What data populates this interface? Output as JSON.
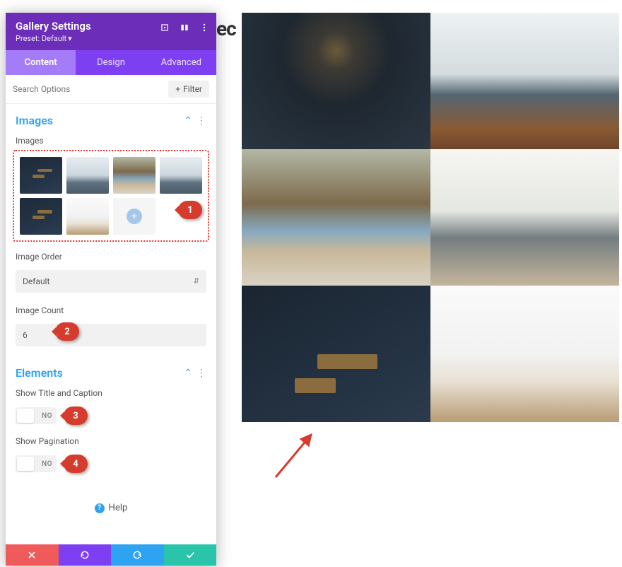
{
  "bg_text": "ec",
  "header": {
    "title": "Gallery Settings",
    "preset_label": "Preset: Default"
  },
  "tabs": {
    "content": "Content",
    "design": "Design",
    "advanced": "Advanced"
  },
  "search": {
    "placeholder": "Search Options",
    "filter_label": "Filter"
  },
  "sections": {
    "images": {
      "title": "Images",
      "images_label": "Images",
      "order_label": "Image Order",
      "order_value": "Default",
      "count_label": "Image Count",
      "count_value": "6"
    },
    "elements": {
      "title": "Elements",
      "title_caption_label": "Show Title and Caption",
      "title_caption_value": "NO",
      "pagination_label": "Show Pagination",
      "pagination_value": "NO"
    }
  },
  "help_label": "Help",
  "annotations": {
    "b1": "1",
    "b2": "2",
    "b3": "3",
    "b4": "4"
  }
}
